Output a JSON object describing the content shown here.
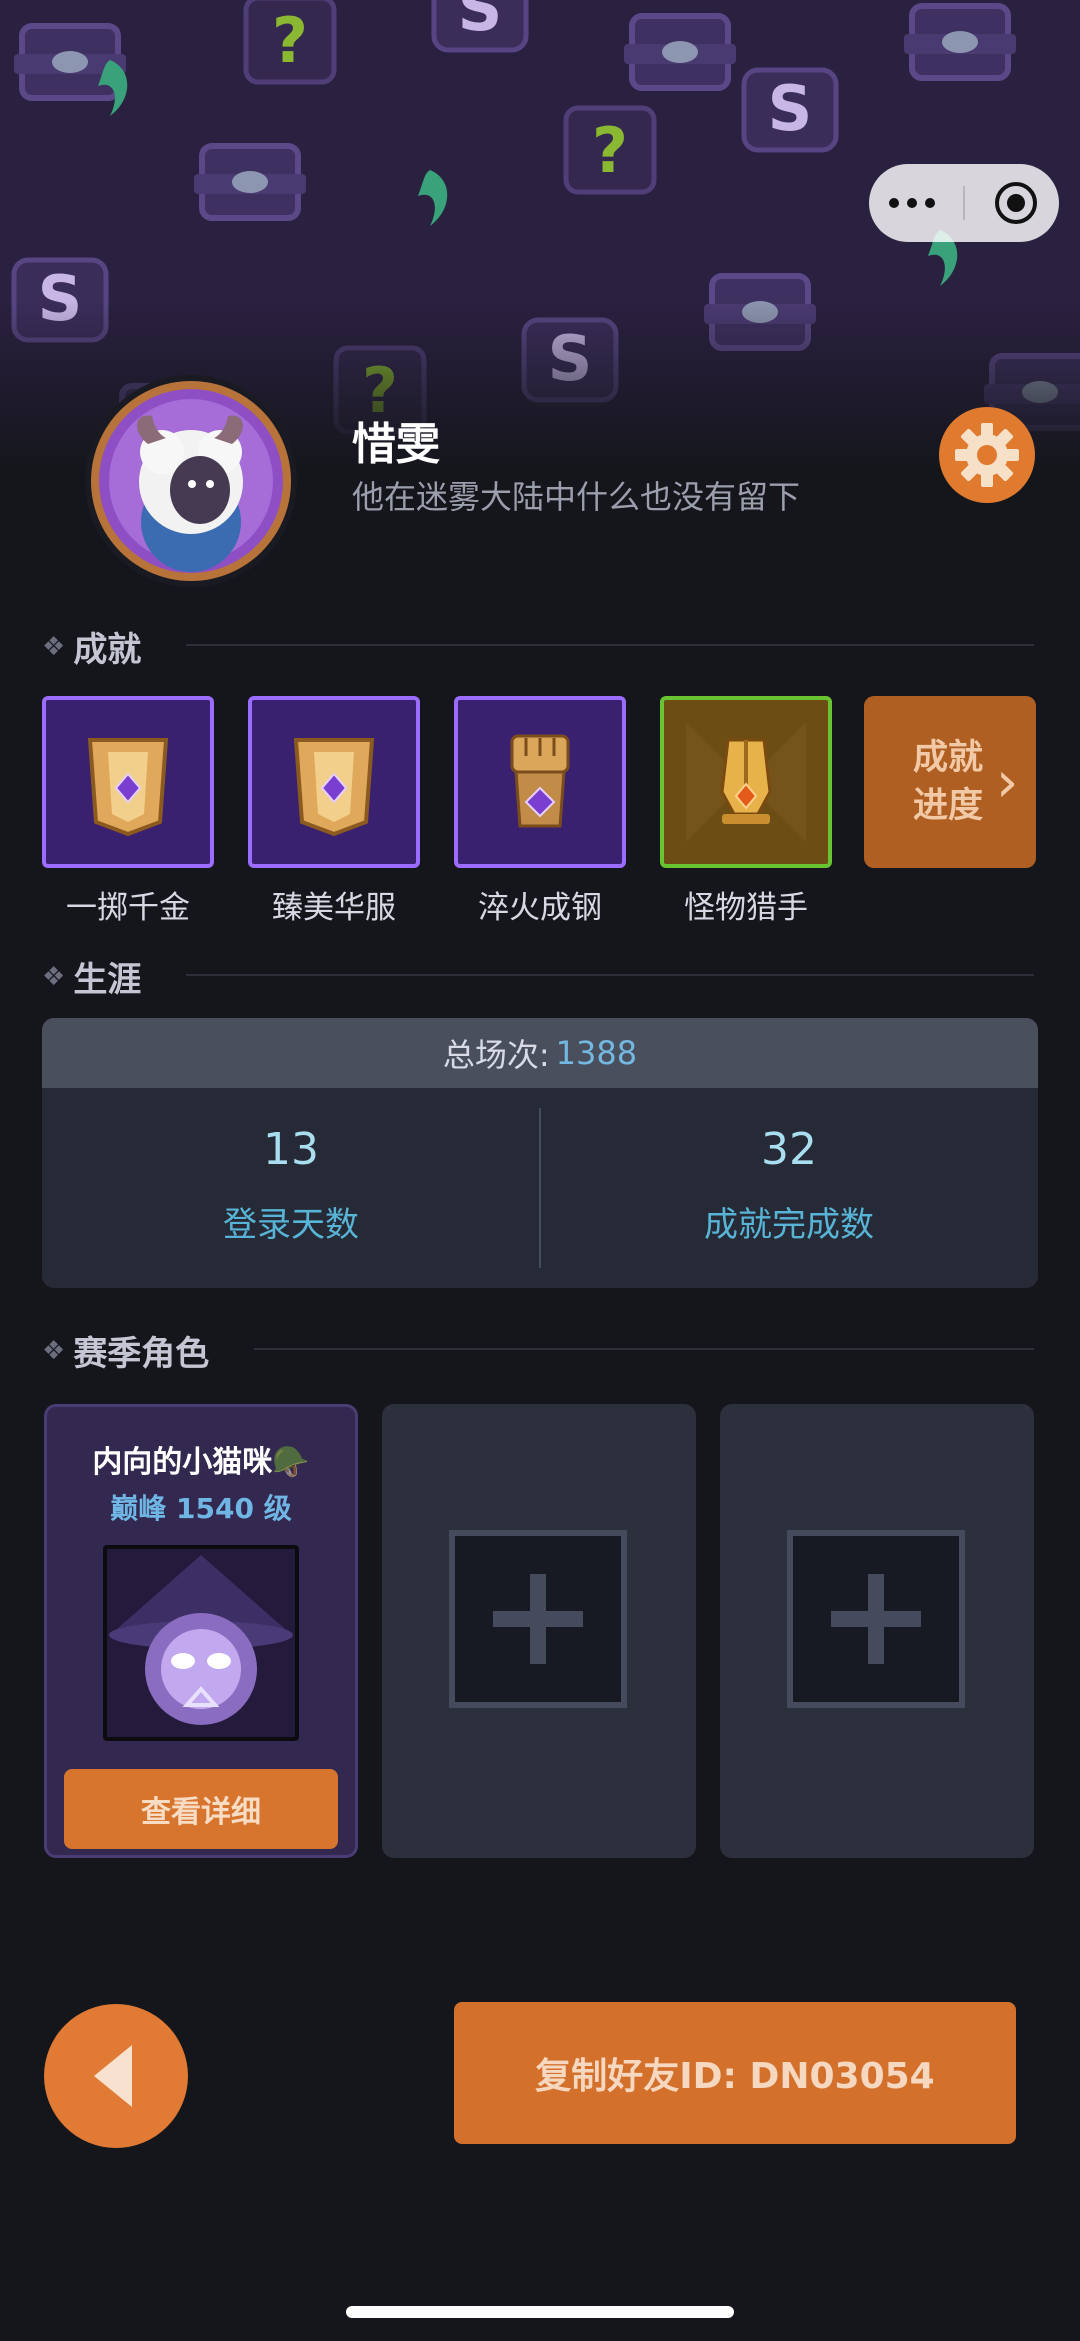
{
  "profile": {
    "name": "惜雯",
    "bio": "他在迷雾大陆中什么也没有留下"
  },
  "icons": {
    "menu": "more-dots-icon",
    "close": "mini-program-close-icon",
    "settings": "gear-icon",
    "back": "back-arrow-icon",
    "add": "plus-icon"
  },
  "sections": {
    "achievements": "成就",
    "career": "生涯",
    "season_roles": "赛季角色"
  },
  "achievements": [
    {
      "label": "一掷千金",
      "icon": "golden-banner-icon"
    },
    {
      "label": "臻美华服",
      "icon": "golden-banner-icon"
    },
    {
      "label": "淬火成钢",
      "icon": "raised-fist-icon"
    },
    {
      "label": "怪物猎手",
      "icon": "golden-helmet-icon"
    }
  ],
  "achievement_progress": {
    "line1": "成就",
    "line2": "进度",
    "chevron": "›"
  },
  "career": {
    "total_label": "总场次:",
    "total_value": "1388",
    "stats": [
      {
        "value": "13",
        "label": "登录天数"
      },
      {
        "value": "32",
        "label": "成就完成数"
      }
    ]
  },
  "roles": [
    {
      "name": "内向的小猫咪🪖",
      "level": "巅峰 1540 级",
      "button": "查看详细"
    }
  ],
  "footer": {
    "copy_button": "复制好友ID: DN03054"
  },
  "colors": {
    "accent_orange": "#d7742e",
    "purple_border": "#9b6cff",
    "stat_blue": "#58b4d6"
  }
}
